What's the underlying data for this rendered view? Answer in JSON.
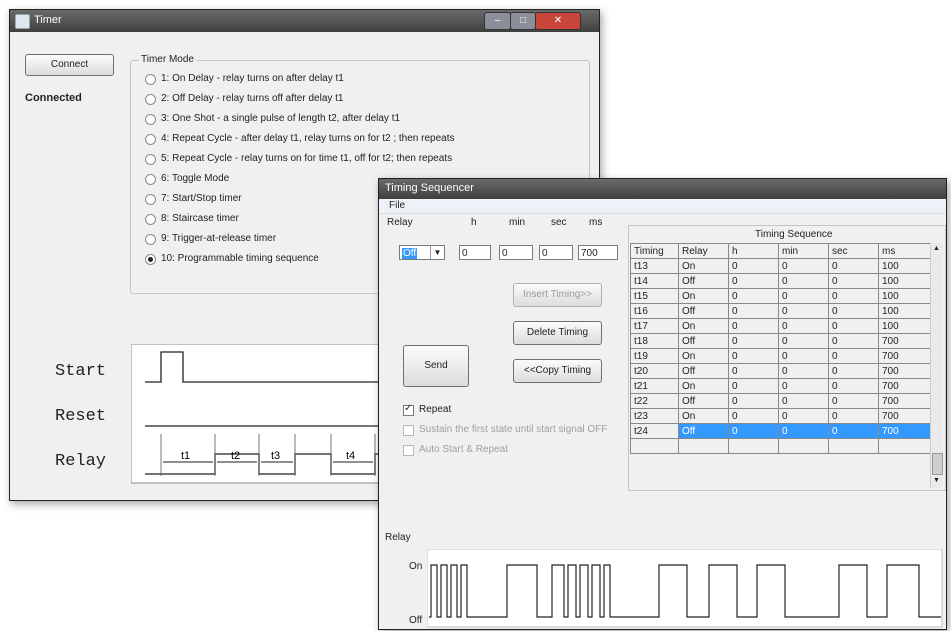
{
  "timer_window": {
    "title": "Timer",
    "connect_button": "Connect",
    "status": "Connected",
    "mode_group_label": "Timer Mode",
    "modes": [
      {
        "label": "1: On Delay - relay turns on after delay t1",
        "selected": false
      },
      {
        "label": "2: Off Delay - relay turns off after delay t1",
        "selected": false
      },
      {
        "label": "3: One Shot - a single pulse of length t2, after delay t1",
        "selected": false
      },
      {
        "label": "4: Repeat Cycle - after delay t1, relay turns on for t2 ; then repeats",
        "selected": false
      },
      {
        "label": "5: Repeat Cycle - relay turns on for time t1, off for t2; then repeats",
        "selected": false
      },
      {
        "label": "6: Toggle Mode",
        "selected": false
      },
      {
        "label": "7: Start/Stop timer",
        "selected": false
      },
      {
        "label": "8: Staircase timer",
        "selected": false
      },
      {
        "label": "9: Trigger-at-release timer",
        "selected": false
      },
      {
        "label": "10: Programmable timing sequence",
        "selected": true
      }
    ],
    "diagram": {
      "signals": [
        "Start",
        "Reset",
        "Relay"
      ],
      "intervals": [
        "t1",
        "t2",
        "t3",
        "t4"
      ]
    }
  },
  "sequencer_window": {
    "title": "Timing Sequencer",
    "menu": [
      "File"
    ],
    "inputs": {
      "relay_label": "Relay",
      "relay_value": "Off",
      "h_label": "h",
      "h_value": "0",
      "min_label": "min",
      "min_value": "0",
      "sec_label": "sec",
      "sec_value": "0",
      "ms_label": "ms",
      "ms_value": "700"
    },
    "buttons": {
      "insert": "Insert Timing>>",
      "delete": "Delete Timing",
      "send": "Send",
      "copy": "<<Copy Timing"
    },
    "checkboxes": [
      {
        "label": "Repeat",
        "checked": true,
        "enabled": true
      },
      {
        "label": "Sustain the first state until start signal OFF",
        "checked": false,
        "enabled": false
      },
      {
        "label": "Auto Start & Repeat",
        "checked": false,
        "enabled": false
      }
    ],
    "table": {
      "title": "Timing Sequence",
      "columns": [
        "Timing",
        "Relay",
        "h",
        "min",
        "sec",
        "ms"
      ],
      "rows": [
        [
          "t13",
          "On",
          "0",
          "0",
          "0",
          "100"
        ],
        [
          "t14",
          "Off",
          "0",
          "0",
          "0",
          "100"
        ],
        [
          "t15",
          "On",
          "0",
          "0",
          "0",
          "100"
        ],
        [
          "t16",
          "Off",
          "0",
          "0",
          "0",
          "100"
        ],
        [
          "t17",
          "On",
          "0",
          "0",
          "0",
          "100"
        ],
        [
          "t18",
          "Off",
          "0",
          "0",
          "0",
          "700"
        ],
        [
          "t19",
          "On",
          "0",
          "0",
          "0",
          "700"
        ],
        [
          "t20",
          "Off",
          "0",
          "0",
          "0",
          "700"
        ],
        [
          "t21",
          "On",
          "0",
          "0",
          "0",
          "700"
        ],
        [
          "t22",
          "Off",
          "0",
          "0",
          "0",
          "700"
        ],
        [
          "t23",
          "On",
          "0",
          "0",
          "0",
          "700"
        ],
        [
          "t24",
          "Off",
          "0",
          "0",
          "0",
          "700"
        ]
      ],
      "selected_row": "t24"
    },
    "waveform": {
      "label": "Relay",
      "on_label": "On",
      "off_label": "Off"
    }
  }
}
